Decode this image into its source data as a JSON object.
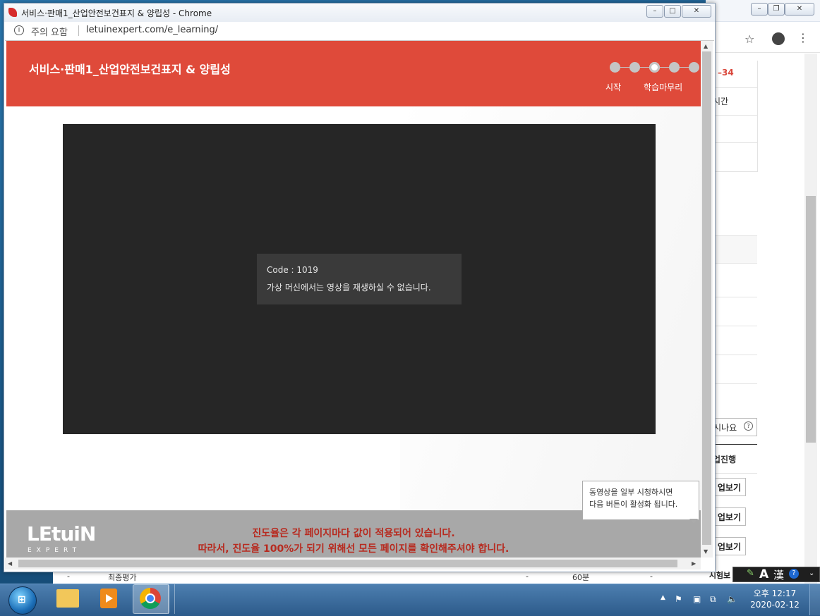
{
  "popup": {
    "window_title": "서비스·판매1_산업안전보건표지 & 양립성 - Chrome",
    "security_warning": "주의 요함",
    "url": "letuinexpert.com/e_learning/"
  },
  "course": {
    "title": "서비스·판매1_산업안전보건표지 & 양립성",
    "steps": {
      "start_label": "시작",
      "finish_label": "학습마무리",
      "total": 5,
      "current": 3
    }
  },
  "video": {
    "error_code": "Code : 1019",
    "error_message": "가상 머신에서는 영상을 재생하실 수 없습니다."
  },
  "tooltip": {
    "line1": "동영상을 일부 시청하시면",
    "line2": "다음 버튼이 활성화 됩니다."
  },
  "footer": {
    "logo": "LEtuiN",
    "logo_sub": "EXPERT",
    "notice_line1": "진도율은 각 페이지마다 값이 적용되어 있습니다.",
    "notice_line2": "따라서, 진도율 100%가 되기 위해선 모든 페이지를 확인해주셔야 합니다."
  },
  "background_page": {
    "cells": [
      "–34",
      "시간",
      "시나요"
    ],
    "buttons": [
      "업진행",
      "업보기",
      "업보기",
      "업보기"
    ],
    "row": {
      "col1": "-",
      "col2": "최종평가",
      "col3": "-",
      "col4": "60분",
      "col5": "-",
      "action": "시험보"
    }
  },
  "taskbar": {
    "time": "오후 12:17",
    "date": "2020-02-12"
  },
  "ime": {
    "mode": "A",
    "hanja": "漢",
    "help": "?"
  },
  "colors": {
    "header_red": "#df4a3a",
    "notice_red": "#b72a1f",
    "footer_gray": "#a8a8a8",
    "video_bg": "#262626"
  }
}
